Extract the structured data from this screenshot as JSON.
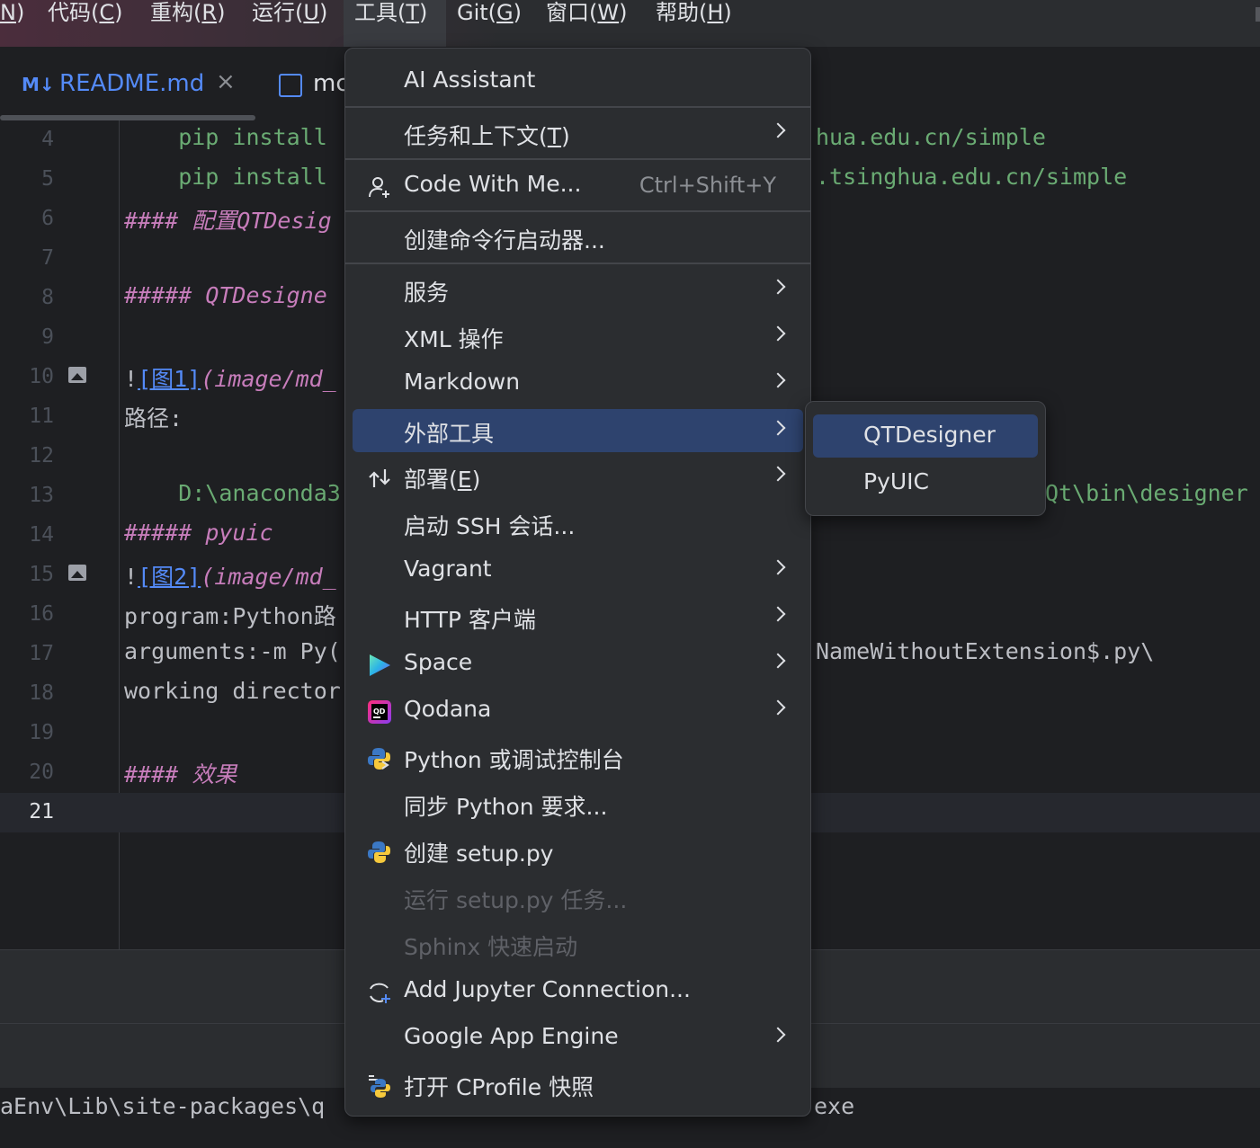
{
  "menubar": {
    "items": [
      {
        "pre": "",
        "key": "N",
        "post": ")"
      },
      {
        "pre": "代码(",
        "key": "C",
        "post": ")"
      },
      {
        "pre": "重构(",
        "key": "R",
        "post": ")"
      },
      {
        "pre": "运行(",
        "key": "U",
        "post": ")"
      },
      {
        "pre": "工具(",
        "key": "T",
        "post": ")"
      },
      {
        "pre": "Git(",
        "key": "G",
        "post": ")"
      },
      {
        "pre": "窗口(",
        "key": "W",
        "post": ")"
      },
      {
        "pre": "帮助(",
        "key": "H",
        "post": ")"
      }
    ]
  },
  "tabs": {
    "readme": {
      "icon_text": "M↓",
      "label": "README.md",
      "close": "×"
    },
    "second": {
      "label": "mc"
    }
  },
  "editor": {
    "lines": [
      {
        "n": "4",
        "left": "    pip install",
        "right": "hua.edu.cn/simple"
      },
      {
        "n": "5",
        "left": "    pip install",
        "right": ".tsinghua.edu.cn/simple"
      },
      {
        "n": "6",
        "hdr": "#### ",
        "text": "配置QTDesig"
      },
      {
        "n": "7"
      },
      {
        "n": "8",
        "hdr": "##### ",
        "text": "QTDesigne"
      },
      {
        "n": "9"
      },
      {
        "n": "10",
        "bang": "!",
        "link": "[图1]",
        "path": "(image/md_"
      },
      {
        "n": "11",
        "plain": "路径:"
      },
      {
        "n": "12"
      },
      {
        "n": "13",
        "path_green": "    D:\\anaconda3",
        "right": "Qt\\bin\\designer"
      },
      {
        "n": "14",
        "hdr": "##### ",
        "text": "pyuic"
      },
      {
        "n": "15",
        "bang": "!",
        "link": "[图2]",
        "path": "(image/md_"
      },
      {
        "n": "16",
        "plain": "program:Python路"
      },
      {
        "n": "17",
        "plain": "arguments:-m Py(",
        "right": "NameWithoutExtension$.py\\"
      },
      {
        "n": "18",
        "plain": "working director"
      },
      {
        "n": "19"
      },
      {
        "n": "20",
        "hdr": "#### ",
        "text": "效果"
      },
      {
        "n": "21"
      }
    ]
  },
  "terminal": {
    "left": "aEnv\\Lib\\site-packages\\q",
    "right": "exe"
  },
  "tools_menu": {
    "items": [
      {
        "label": "AI Assistant"
      },
      {
        "label": "任务和上下文(",
        "key": "T",
        "post": ")"
      },
      {
        "label": "Code With Me...",
        "shortcut": "Ctrl+Shift+Y",
        "icon": "person-add-icon"
      },
      {
        "label": "创建命令行启动器..."
      },
      {
        "label": "服务"
      },
      {
        "label": "XML 操作"
      },
      {
        "label": "Markdown"
      },
      {
        "label": "外部工具"
      },
      {
        "label": "部署(",
        "key": "E",
        "post": ")",
        "icon": "deploy-icon"
      },
      {
        "label": "启动 SSH 会话..."
      },
      {
        "label": "Vagrant"
      },
      {
        "label": "HTTP 客户端"
      },
      {
        "label": "Space",
        "icon": "space-icon"
      },
      {
        "label": "Qodana",
        "icon": "qodana-icon"
      },
      {
        "label": "Python 或调试控制台",
        "icon": "python-console-icon"
      },
      {
        "label": "同步 Python 要求..."
      },
      {
        "label": "创建 setup.py",
        "icon": "python-icon"
      },
      {
        "label": "运行 setup.py 任务..."
      },
      {
        "label": "Sphinx 快速启动"
      },
      {
        "label": "Add Jupyter Connection...",
        "icon": "jupyter-connection-icon"
      },
      {
        "label": "Google App Engine"
      },
      {
        "label": "打开 CProfile 快照",
        "icon": "cprofile-icon"
      }
    ]
  },
  "submenu": {
    "items": [
      {
        "label": "QTDesigner"
      },
      {
        "label": "PyUIC"
      }
    ]
  },
  "colors": {
    "accent": "#548af7",
    "selection": "#2e436e",
    "menu_bg": "#2b2d30",
    "editor_bg": "#1e1f22"
  }
}
